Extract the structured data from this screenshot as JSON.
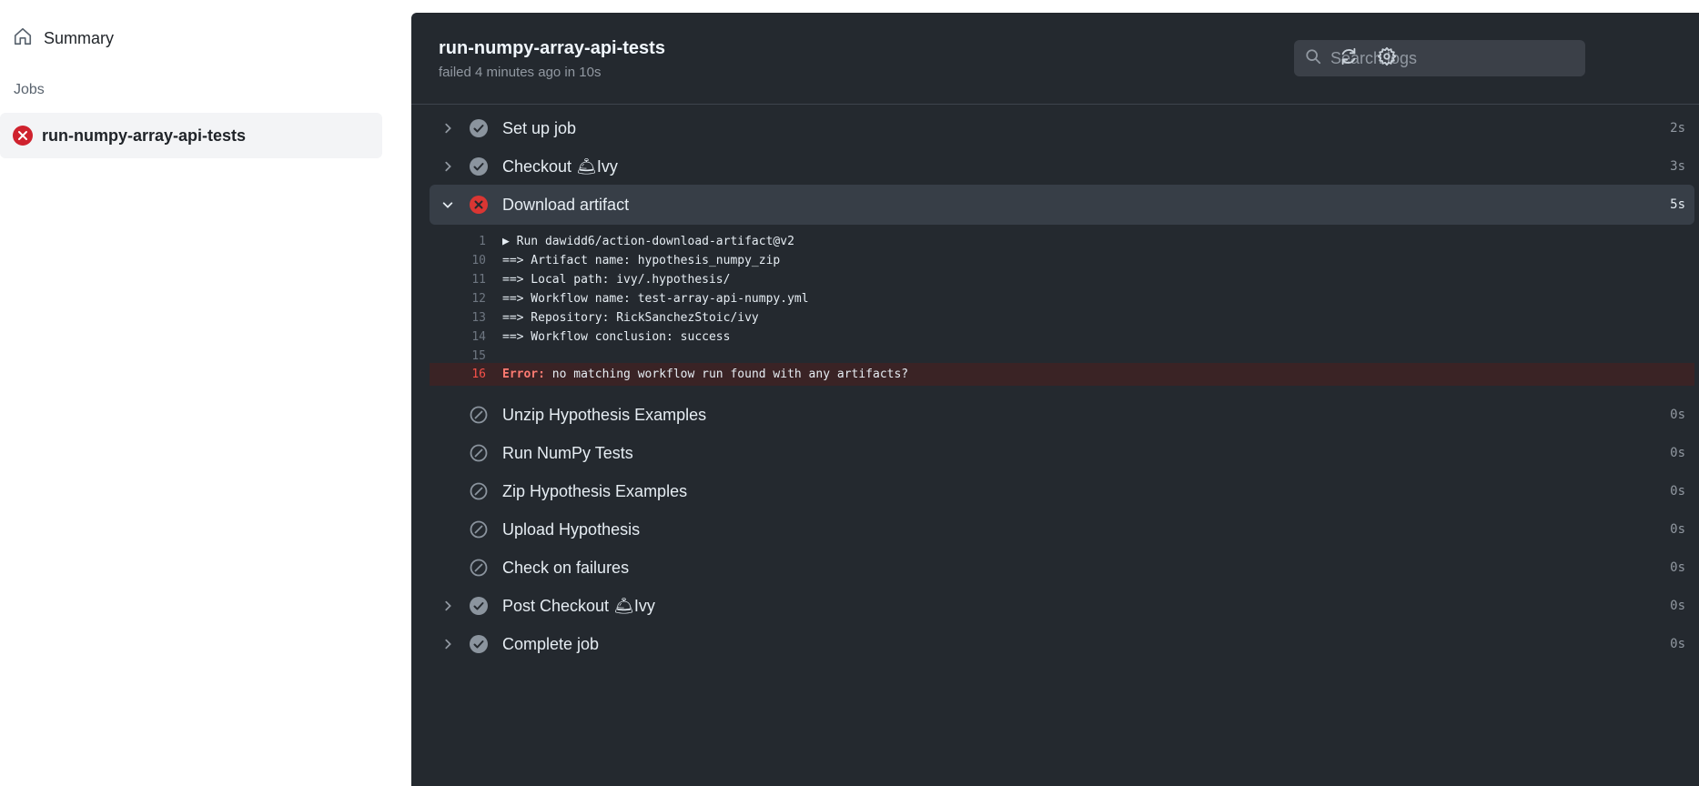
{
  "sidebar": {
    "summary_label": "Summary",
    "jobs_heading": "Jobs",
    "job_name": "run-numpy-array-api-tests"
  },
  "header": {
    "title": "run-numpy-array-api-tests",
    "subtitle": "failed 4 minutes ago in 10s",
    "search_placeholder": "Search logs"
  },
  "steps": [
    {
      "name": "Set up job",
      "status": "success",
      "time": "2s",
      "collapsible": true
    },
    {
      "name": "Checkout 🛎Ivy",
      "status": "success",
      "time": "3s",
      "collapsible": true
    },
    {
      "name": "Download artifact",
      "status": "failure",
      "time": "5s",
      "collapsible": true,
      "expanded": true
    },
    {
      "name": "Unzip Hypothesis Examples",
      "status": "skipped",
      "time": "0s"
    },
    {
      "name": "Run NumPy Tests",
      "status": "skipped",
      "time": "0s"
    },
    {
      "name": "Zip Hypothesis Examples",
      "status": "skipped",
      "time": "0s"
    },
    {
      "name": "Upload Hypothesis",
      "status": "skipped",
      "time": "0s"
    },
    {
      "name": "Check on failures",
      "status": "skipped",
      "time": "0s"
    },
    {
      "name": "Post Checkout 🛎Ivy",
      "status": "success",
      "time": "0s",
      "collapsible": true
    },
    {
      "name": "Complete job",
      "status": "success",
      "time": "0s",
      "collapsible": true
    }
  ],
  "log": [
    {
      "n": "1",
      "text": "▶ Run dawidd6/action-download-artifact@v2"
    },
    {
      "n": "10",
      "text": "==> Artifact name: hypothesis_numpy_zip"
    },
    {
      "n": "11",
      "text": "==> Local path: ivy/.hypothesis/"
    },
    {
      "n": "12",
      "text": "==> Workflow name: test-array-api-numpy.yml"
    },
    {
      "n": "13",
      "text": "==> Repository: RickSanchezStoic/ivy"
    },
    {
      "n": "14",
      "text": "==> Workflow conclusion: success"
    },
    {
      "n": "15",
      "text": ""
    },
    {
      "n": "16",
      "keyword": "Error:",
      "text": " no matching workflow run found with any artifacts?",
      "error": true
    }
  ],
  "colors": {
    "failure": "#cf222e",
    "success_icon": "#8b949e",
    "panel_bg": "#24292f"
  }
}
